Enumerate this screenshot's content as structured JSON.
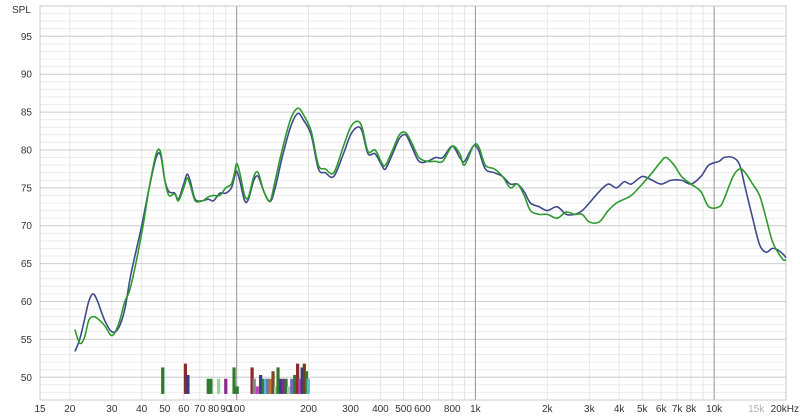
{
  "chart_data": {
    "type": "line",
    "ylabel": "SPL",
    "x_scale": "log",
    "xlim": [
      15,
      20000
    ],
    "ylim": [
      47,
      99
    ],
    "grid": true,
    "x_ticks": [
      {
        "value": 15,
        "label": "15"
      },
      {
        "value": 20,
        "label": "20"
      },
      {
        "value": 30,
        "label": "30"
      },
      {
        "value": 40,
        "label": "40"
      },
      {
        "value": 50,
        "label": "50"
      },
      {
        "value": 60,
        "label": "60"
      },
      {
        "value": 70,
        "label": "70"
      },
      {
        "value": 80,
        "label": "80"
      },
      {
        "value": 90,
        "label": "90"
      },
      {
        "value": 100,
        "label": "100"
      },
      {
        "value": 200,
        "label": "200"
      },
      {
        "value": 300,
        "label": "300"
      },
      {
        "value": 400,
        "label": "400"
      },
      {
        "value": 500,
        "label": "500"
      },
      {
        "value": 600,
        "label": "600"
      },
      {
        "value": 800,
        "label": "800"
      },
      {
        "value": 1000,
        "label": "1k"
      },
      {
        "value": 2000,
        "label": "2k"
      },
      {
        "value": 3000,
        "label": "3k"
      },
      {
        "value": 4000,
        "label": "4k"
      },
      {
        "value": 5000,
        "label": "5k"
      },
      {
        "value": 6000,
        "label": "6k"
      },
      {
        "value": 7000,
        "label": "7k"
      },
      {
        "value": 8000,
        "label": "8k"
      },
      {
        "value": 10000,
        "label": "10k"
      },
      {
        "value": 15000,
        "label": "15k"
      },
      {
        "value": 20000,
        "label": "20kHz"
      }
    ],
    "y_ticks": [
      50,
      55,
      60,
      65,
      70,
      75,
      80,
      85,
      90,
      95
    ],
    "series": [
      {
        "color": "#3f4a8a",
        "points": [
          [
            21,
            53.4
          ],
          [
            22,
            55
          ],
          [
            23,
            57.5
          ],
          [
            24,
            60
          ],
          [
            25,
            61
          ],
          [
            26,
            60.2
          ],
          [
            28,
            57.5
          ],
          [
            30,
            56
          ],
          [
            32,
            56.5
          ],
          [
            34,
            59
          ],
          [
            36,
            63.5
          ],
          [
            40,
            70
          ],
          [
            43,
            75
          ],
          [
            46,
            79
          ],
          [
            48,
            79.3
          ],
          [
            50,
            76
          ],
          [
            52,
            74.5
          ],
          [
            55,
            74.3
          ],
          [
            57,
            73.5
          ],
          [
            60,
            75.5
          ],
          [
            62,
            76.8
          ],
          [
            64,
            75.8
          ],
          [
            67,
            73.5
          ],
          [
            72,
            73.3
          ],
          [
            76,
            73.5
          ],
          [
            80,
            73.3
          ],
          [
            85,
            74.3
          ],
          [
            90,
            74.3
          ],
          [
            95,
            75
          ],
          [
            98,
            76.5
          ],
          [
            100,
            77.2
          ],
          [
            103,
            76
          ],
          [
            108,
            73.3
          ],
          [
            112,
            73.5
          ],
          [
            118,
            76
          ],
          [
            123,
            76.5
          ],
          [
            130,
            74.5
          ],
          [
            138,
            73.2
          ],
          [
            145,
            75
          ],
          [
            155,
            79
          ],
          [
            168,
            83
          ],
          [
            180,
            84.8
          ],
          [
            190,
            84
          ],
          [
            205,
            82
          ],
          [
            220,
            77.5
          ],
          [
            235,
            77
          ],
          [
            255,
            76.5
          ],
          [
            280,
            79.5
          ],
          [
            300,
            82
          ],
          [
            320,
            83
          ],
          [
            335,
            82.5
          ],
          [
            355,
            79.5
          ],
          [
            380,
            79.5
          ],
          [
            405,
            78
          ],
          [
            420,
            77.5
          ],
          [
            450,
            79.5
          ],
          [
            480,
            81.5
          ],
          [
            510,
            82
          ],
          [
            540,
            80.5
          ],
          [
            580,
            78.5
          ],
          [
            630,
            78.5
          ],
          [
            680,
            79
          ],
          [
            730,
            79
          ],
          [
            800,
            80.5
          ],
          [
            860,
            79
          ],
          [
            900,
            78.5
          ],
          [
            980,
            80.5
          ],
          [
            1030,
            80
          ],
          [
            1100,
            77.5
          ],
          [
            1200,
            77
          ],
          [
            1300,
            76.5
          ],
          [
            1400,
            75.5
          ],
          [
            1500,
            75.5
          ],
          [
            1600,
            74.5
          ],
          [
            1700,
            73
          ],
          [
            1850,
            72.5
          ],
          [
            2000,
            72
          ],
          [
            2200,
            72.5
          ],
          [
            2400,
            71.5
          ],
          [
            2600,
            71.5
          ],
          [
            2800,
            72
          ],
          [
            3000,
            73
          ],
          [
            3300,
            74.5
          ],
          [
            3600,
            75.5
          ],
          [
            3900,
            75
          ],
          [
            4200,
            75.8
          ],
          [
            4500,
            75.5
          ],
          [
            5000,
            76.5
          ],
          [
            5500,
            76
          ],
          [
            6000,
            75.5
          ],
          [
            6600,
            76
          ],
          [
            7300,
            76
          ],
          [
            8000,
            75.5
          ],
          [
            8800,
            76.5
          ],
          [
            9500,
            78
          ],
          [
            10500,
            78.5
          ],
          [
            11000,
            79
          ],
          [
            12000,
            79
          ],
          [
            12800,
            78
          ],
          [
            13500,
            75
          ],
          [
            14500,
            71
          ],
          [
            15500,
            67.5
          ],
          [
            16500,
            66.5
          ],
          [
            17500,
            67
          ],
          [
            18500,
            66.8
          ],
          [
            19500,
            66.2
          ],
          [
            20000,
            65.8
          ]
        ]
      },
      {
        "color": "#2e9a2e",
        "points": [
          [
            21,
            56.3
          ],
          [
            22,
            54.5
          ],
          [
            23,
            55.2
          ],
          [
            24,
            57.5
          ],
          [
            25,
            58
          ],
          [
            26,
            57.8
          ],
          [
            28,
            56.8
          ],
          [
            30,
            55.5
          ],
          [
            32,
            57
          ],
          [
            34,
            60
          ],
          [
            36,
            62
          ],
          [
            40,
            69
          ],
          [
            43,
            75
          ],
          [
            46,
            79.5
          ],
          [
            48,
            79.7
          ],
          [
            50,
            76
          ],
          [
            52,
            74
          ],
          [
            55,
            74.2
          ],
          [
            57,
            73.3
          ],
          [
            60,
            75
          ],
          [
            62,
            76.3
          ],
          [
            64,
            75.3
          ],
          [
            67,
            73.3
          ],
          [
            72,
            73.3
          ],
          [
            76,
            73.8
          ],
          [
            80,
            74
          ],
          [
            85,
            74
          ],
          [
            90,
            75
          ],
          [
            95,
            75.5
          ],
          [
            98,
            77
          ],
          [
            100,
            78.2
          ],
          [
            103,
            77
          ],
          [
            108,
            74
          ],
          [
            112,
            73.8
          ],
          [
            118,
            76.5
          ],
          [
            123,
            77
          ],
          [
            130,
            74.5
          ],
          [
            138,
            73.3
          ],
          [
            145,
            76
          ],
          [
            155,
            80
          ],
          [
            168,
            84
          ],
          [
            180,
            85.5
          ],
          [
            190,
            84.7
          ],
          [
            205,
            82.5
          ],
          [
            220,
            78
          ],
          [
            235,
            77.5
          ],
          [
            255,
            77
          ],
          [
            280,
            80.5
          ],
          [
            300,
            83
          ],
          [
            320,
            83.8
          ],
          [
            335,
            83
          ],
          [
            355,
            79.8
          ],
          [
            380,
            80
          ],
          [
            405,
            78.3
          ],
          [
            420,
            78
          ],
          [
            450,
            80
          ],
          [
            480,
            82
          ],
          [
            510,
            82.3
          ],
          [
            540,
            81
          ],
          [
            580,
            79
          ],
          [
            630,
            78.5
          ],
          [
            680,
            78.5
          ],
          [
            730,
            78.5
          ],
          [
            800,
            80.5
          ],
          [
            860,
            79.5
          ],
          [
            900,
            78
          ],
          [
            980,
            80.5
          ],
          [
            1030,
            80.5
          ],
          [
            1100,
            78
          ],
          [
            1200,
            77.5
          ],
          [
            1300,
            76.5
          ],
          [
            1400,
            75
          ],
          [
            1500,
            75.5
          ],
          [
            1600,
            74
          ],
          [
            1700,
            72
          ],
          [
            1850,
            71.5
          ],
          [
            2000,
            71.5
          ],
          [
            2200,
            71
          ],
          [
            2400,
            71.8
          ],
          [
            2600,
            71.5
          ],
          [
            2800,
            71.5
          ],
          [
            3000,
            70.5
          ],
          [
            3300,
            70.5
          ],
          [
            3600,
            72
          ],
          [
            3900,
            73
          ],
          [
            4200,
            73.5
          ],
          [
            4500,
            74
          ],
          [
            5000,
            75.5
          ],
          [
            5500,
            77
          ],
          [
            6000,
            78.5
          ],
          [
            6300,
            79
          ],
          [
            6800,
            78
          ],
          [
            7300,
            76.5
          ],
          [
            8000,
            75.5
          ],
          [
            8800,
            74.5
          ],
          [
            9500,
            72.5
          ],
          [
            10500,
            72.5
          ],
          [
            11000,
            73.5
          ],
          [
            12000,
            76.5
          ],
          [
            12800,
            77.5
          ],
          [
            13500,
            77
          ],
          [
            14500,
            75.5
          ],
          [
            15500,
            74
          ],
          [
            16500,
            71
          ],
          [
            17500,
            68
          ],
          [
            18500,
            66.5
          ],
          [
            19500,
            65.5
          ],
          [
            20000,
            65.5
          ]
        ]
      }
    ],
    "filter_bars": [
      {
        "x": 49.0,
        "top": 51.3,
        "color": "#2f7a2f"
      },
      {
        "x": 61.0,
        "top": 51.8,
        "color": "#8a2a2a"
      },
      {
        "x": 62.5,
        "top": 50.3,
        "color": "#3a3a8a"
      },
      {
        "x": 76.0,
        "top": 49.8,
        "color": "#2f7a2f"
      },
      {
        "x": 78.0,
        "top": 49.8,
        "color": "#2f7a2f"
      },
      {
        "x": 84.0,
        "top": 49.8,
        "color": "#9ecf9e"
      },
      {
        "x": 90.0,
        "top": 49.8,
        "color": "#8a2a8a"
      },
      {
        "x": 97.5,
        "top": 51.3,
        "color": "#2f7a2f"
      },
      {
        "x": 100.5,
        "top": 48.8,
        "color": "#2f7a2f"
      },
      {
        "x": 116.0,
        "top": 51.3,
        "color": "#8a2a2a"
      },
      {
        "x": 118.5,
        "top": 49.8,
        "color": "#8a8a8a"
      },
      {
        "x": 122.0,
        "top": 48.8,
        "color": "#bb44bb"
      },
      {
        "x": 126.0,
        "top": 50.3,
        "color": "#3a3a8a"
      },
      {
        "x": 129.0,
        "top": 49.8,
        "color": "#2f7a2f"
      },
      {
        "x": 132.0,
        "top": 49.8,
        "color": "#55bbcc"
      },
      {
        "x": 135.0,
        "top": 49.8,
        "color": "#6e6ebb"
      },
      {
        "x": 138.0,
        "top": 49.8,
        "color": "#bb7733"
      },
      {
        "x": 142.0,
        "top": 50.8,
        "color": "#7a4a2a"
      },
      {
        "x": 145.5,
        "top": 48.8,
        "color": "#9ecf9e"
      },
      {
        "x": 149.0,
        "top": 51.3,
        "color": "#2f7a2f"
      },
      {
        "x": 153.0,
        "top": 49.8,
        "color": "#3a3a8a"
      },
      {
        "x": 157.0,
        "top": 49.8,
        "color": "#8a2a8a"
      },
      {
        "x": 161.0,
        "top": 49.8,
        "color": "#2f7a2f"
      },
      {
        "x": 165.0,
        "top": 48.8,
        "color": "#9ecf9e"
      },
      {
        "x": 170.0,
        "top": 49.8,
        "color": "#6e6ebb"
      },
      {
        "x": 175.0,
        "top": 50.3,
        "color": "#2f7a2f"
      },
      {
        "x": 180.0,
        "top": 51.8,
        "color": "#8a2a2a"
      },
      {
        "x": 184.0,
        "top": 49.8,
        "color": "#bb44bb"
      },
      {
        "x": 188.0,
        "top": 51.3,
        "color": "#3a3a8a"
      },
      {
        "x": 192.0,
        "top": 51.8,
        "color": "#7a3a1a"
      },
      {
        "x": 196.0,
        "top": 50.8,
        "color": "#2f7a2f"
      },
      {
        "x": 199.5,
        "top": 49.8,
        "color": "#55bbcc"
      }
    ]
  }
}
